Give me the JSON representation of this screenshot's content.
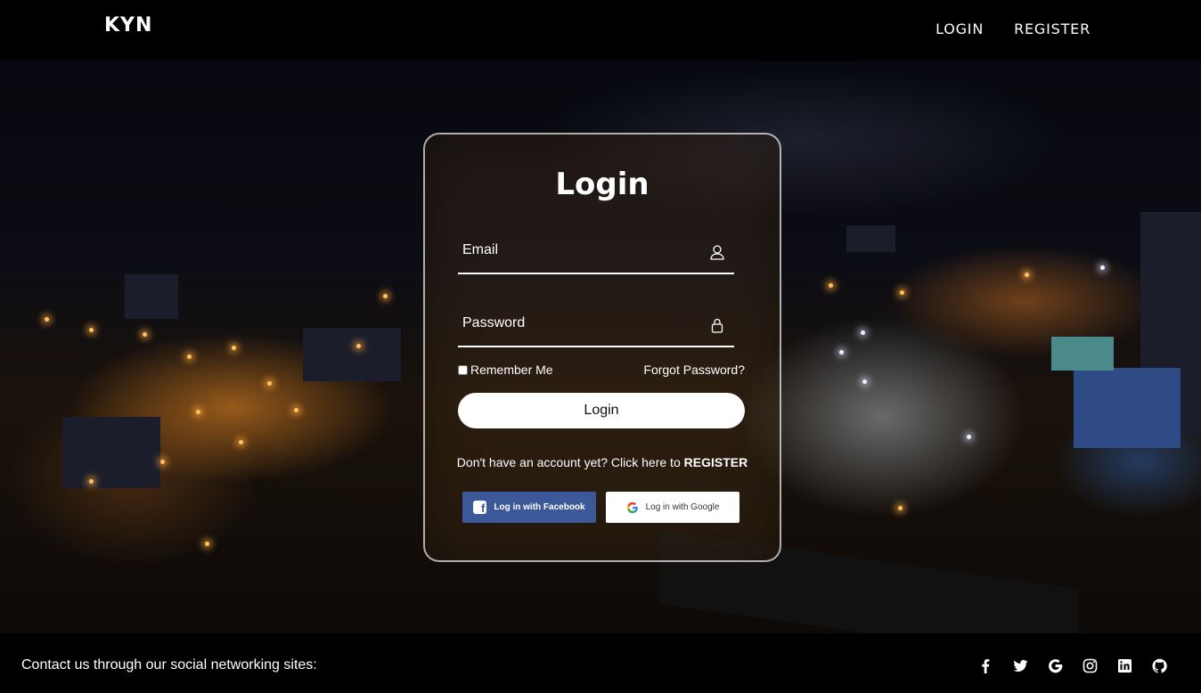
{
  "header": {
    "brand": "KYN",
    "nav": {
      "login": "LOGIN",
      "register": "REGISTER"
    }
  },
  "login_card": {
    "title": "Login",
    "email_label": "Email",
    "password_label": "Password",
    "remember_label": "Remember Me",
    "forgot_label": "Forgot Password?",
    "submit_label": "Login",
    "register_prompt": "Don't have an account yet? Click here to",
    "register_link": "REGISTER",
    "facebook_label": "Log in with Facebook",
    "google_label": "Log in with Google",
    "icons": {
      "email": "user-icon",
      "password": "lock-icon"
    }
  },
  "footer": {
    "contact_text": "Contact us through our social networking sites:",
    "social_icons": [
      "facebook-icon",
      "twitter-icon",
      "google-icon",
      "instagram-icon",
      "linkedin-icon",
      "github-icon"
    ]
  },
  "colors": {
    "facebook": "#3b5998",
    "bar_background": "#000000",
    "button_background": "#ffffff"
  }
}
